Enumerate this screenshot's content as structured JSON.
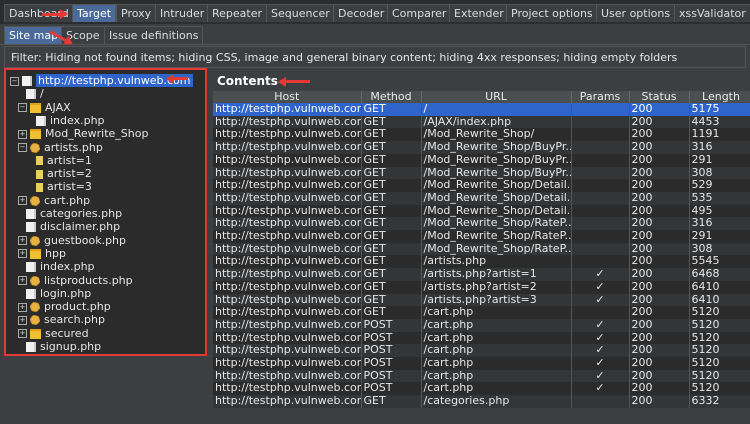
{
  "tabs": [
    "Dashboard",
    "Target",
    "Proxy",
    "Intruder",
    "Repeater",
    "Sequencer",
    "Decoder",
    "Comparer",
    "Extender",
    "Project options",
    "User options",
    "xssValidator"
  ],
  "active_tab": "Target",
  "subtabs": [
    "Site map",
    "Scope",
    "Issue definitions"
  ],
  "active_subtab": "Site map",
  "filter_text": "Filter: Hiding not found items;  hiding CSS, image and general binary content;  hiding 4xx responses;  hiding empty folders",
  "tree": [
    {
      "label": "http://testphp.vulnweb.com",
      "icon": "root",
      "expander": "minus",
      "selected": true
    },
    {
      "label": "/",
      "icon": "file",
      "expander": ""
    },
    {
      "label": "AJAX",
      "icon": "folder-open",
      "expander": "minus"
    },
    {
      "label": "index.php",
      "icon": "file",
      "expander": ""
    },
    {
      "label": "Mod_Rewrite_Shop",
      "icon": "folder",
      "expander": "plus"
    },
    {
      "label": "artists.php",
      "icon": "gear",
      "expander": "minus"
    },
    {
      "label": "artist=1",
      "icon": "page",
      "expander": ""
    },
    {
      "label": "artist=2",
      "icon": "page",
      "expander": ""
    },
    {
      "label": "artist=3",
      "icon": "page",
      "expander": ""
    },
    {
      "label": "cart.php",
      "icon": "gear",
      "expander": "plus"
    },
    {
      "label": "categories.php",
      "icon": "file",
      "expander": ""
    },
    {
      "label": "disclaimer.php",
      "icon": "file",
      "expander": ""
    },
    {
      "label": "guestbook.php",
      "icon": "gear",
      "expander": "plus"
    },
    {
      "label": "hpp",
      "icon": "folder",
      "expander": "plus"
    },
    {
      "label": "index.php",
      "icon": "file",
      "expander": ""
    },
    {
      "label": "listproducts.php",
      "icon": "gear",
      "expander": "plus"
    },
    {
      "label": "login.php",
      "icon": "file",
      "expander": ""
    },
    {
      "label": "product.php",
      "icon": "gear",
      "expander": "plus"
    },
    {
      "label": "search.php",
      "icon": "gear",
      "expander": "plus"
    },
    {
      "label": "secured",
      "icon": "folder",
      "expander": "plus"
    },
    {
      "label": "signup.php",
      "icon": "file",
      "expander": ""
    }
  ],
  "contents_title": "Contents",
  "columns": [
    "Host",
    "Method",
    "URL",
    "Params",
    "Status",
    "Length"
  ],
  "check_mark": "✓",
  "rows": [
    {
      "host": "http://testphp.vulnweb.com",
      "method": "GET",
      "url": "/",
      "params": "",
      "status": "200",
      "length": "5175"
    },
    {
      "host": "http://testphp.vulnweb.com",
      "method": "GET",
      "url": "/AJAX/index.php",
      "params": "",
      "status": "200",
      "length": "4453"
    },
    {
      "host": "http://testphp.vulnweb.com",
      "method": "GET",
      "url": "/Mod_Rewrite_Shop/",
      "params": "",
      "status": "200",
      "length": "1191"
    },
    {
      "host": "http://testphp.vulnweb.com",
      "method": "GET",
      "url": "/Mod_Rewrite_Shop/BuyPr...",
      "params": "",
      "status": "200",
      "length": "316"
    },
    {
      "host": "http://testphp.vulnweb.com",
      "method": "GET",
      "url": "/Mod_Rewrite_Shop/BuyPr...",
      "params": "",
      "status": "200",
      "length": "291"
    },
    {
      "host": "http://testphp.vulnweb.com",
      "method": "GET",
      "url": "/Mod_Rewrite_Shop/BuyPr...",
      "params": "",
      "status": "200",
      "length": "308"
    },
    {
      "host": "http://testphp.vulnweb.com",
      "method": "GET",
      "url": "/Mod_Rewrite_Shop/Detail...",
      "params": "",
      "status": "200",
      "length": "529"
    },
    {
      "host": "http://testphp.vulnweb.com",
      "method": "GET",
      "url": "/Mod_Rewrite_Shop/Detail...",
      "params": "",
      "status": "200",
      "length": "535"
    },
    {
      "host": "http://testphp.vulnweb.com",
      "method": "GET",
      "url": "/Mod_Rewrite_Shop/Detail...",
      "params": "",
      "status": "200",
      "length": "495"
    },
    {
      "host": "http://testphp.vulnweb.com",
      "method": "GET",
      "url": "/Mod_Rewrite_Shop/RateP...",
      "params": "",
      "status": "200",
      "length": "316"
    },
    {
      "host": "http://testphp.vulnweb.com",
      "method": "GET",
      "url": "/Mod_Rewrite_Shop/RateP...",
      "params": "",
      "status": "200",
      "length": "291"
    },
    {
      "host": "http://testphp.vulnweb.com",
      "method": "GET",
      "url": "/Mod_Rewrite_Shop/RateP...",
      "params": "",
      "status": "200",
      "length": "308"
    },
    {
      "host": "http://testphp.vulnweb.com",
      "method": "GET",
      "url": "/artists.php",
      "params": "",
      "status": "200",
      "length": "5545"
    },
    {
      "host": "http://testphp.vulnweb.com",
      "method": "GET",
      "url": "/artists.php?artist=1",
      "params": "✓",
      "status": "200",
      "length": "6468"
    },
    {
      "host": "http://testphp.vulnweb.com",
      "method": "GET",
      "url": "/artists.php?artist=2",
      "params": "✓",
      "status": "200",
      "length": "6410"
    },
    {
      "host": "http://testphp.vulnweb.com",
      "method": "GET",
      "url": "/artists.php?artist=3",
      "params": "✓",
      "status": "200",
      "length": "6410"
    },
    {
      "host": "http://testphp.vulnweb.com",
      "method": "GET",
      "url": "/cart.php",
      "params": "",
      "status": "200",
      "length": "5120"
    },
    {
      "host": "http://testphp.vulnweb.com",
      "method": "POST",
      "url": "/cart.php",
      "params": "✓",
      "status": "200",
      "length": "5120"
    },
    {
      "host": "http://testphp.vulnweb.com",
      "method": "POST",
      "url": "/cart.php",
      "params": "✓",
      "status": "200",
      "length": "5120"
    },
    {
      "host": "http://testphp.vulnweb.com",
      "method": "POST",
      "url": "/cart.php",
      "params": "✓",
      "status": "200",
      "length": "5120"
    },
    {
      "host": "http://testphp.vulnweb.com",
      "method": "POST",
      "url": "/cart.php",
      "params": "✓",
      "status": "200",
      "length": "5120"
    },
    {
      "host": "http://testphp.vulnweb.com",
      "method": "POST",
      "url": "/cart.php",
      "params": "✓",
      "status": "200",
      "length": "5120"
    },
    {
      "host": "http://testphp.vulnweb.com",
      "method": "POST",
      "url": "/cart.php",
      "params": "✓",
      "status": "200",
      "length": "5120"
    },
    {
      "host": "http://testphp.vulnweb.com",
      "method": "GET",
      "url": "/categories.php",
      "params": "",
      "status": "200",
      "length": "6332"
    }
  ],
  "colors": {
    "accent": "#2f65ca",
    "annotation": "#e53935",
    "tab_active": "#4a6a9a"
  }
}
